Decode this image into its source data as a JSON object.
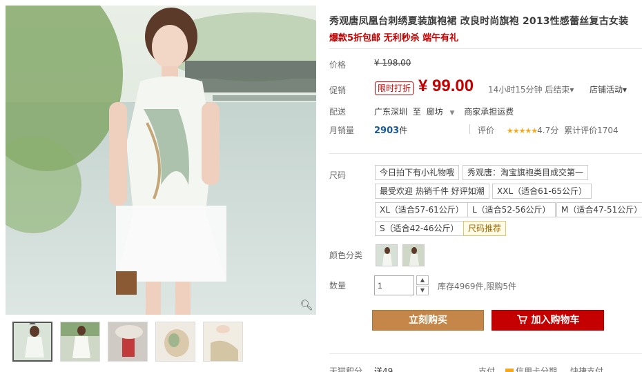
{
  "product": {
    "title": "秀观唐凤凰台刺绣夏装旗袍裙 改良时尚旗袍 2013性感蕾丝复古女装",
    "subtitle": "爆款5折包邮 无利秒杀 端午有礼"
  },
  "price": {
    "label": "价格",
    "original": "¥ 198.00"
  },
  "promo": {
    "label": "促销",
    "tag": "限时打折",
    "price": "¥ 99.00",
    "countdown": "14小时15分钟 后结束▾",
    "shop_activity": "店铺活动▾"
  },
  "shipping": {
    "label": "配送",
    "origin": "广东深圳",
    "to": "至",
    "destination": "廊坊",
    "dest_arrow": "▼",
    "note": "商家承担运费"
  },
  "sales": {
    "label": "月销量",
    "count": "2903",
    "unit": "件",
    "rating_label": "评价",
    "stars": "★★★★★",
    "score": "4.7分",
    "cumulative": "累计评价1704"
  },
  "size": {
    "label": "尺码",
    "options": [
      "今日拍下有小礼物哦",
      "秀观唐：淘宝旗袍类目成交第一",
      "最受欢迎 热销千件 好评如潮",
      "XXL（适合61-65公斤）",
      "XL（适合57-61公斤）",
      "L（适合52-56公斤）",
      "M（适合47-51公斤）",
      "S（适合42-46公斤）",
      "尺码推荐"
    ]
  },
  "color": {
    "label": "颜色分类"
  },
  "quantity": {
    "label": "数量",
    "value": "1",
    "up": "▲",
    "down": "▼",
    "stock": "库存4969件,限购5件"
  },
  "actions": {
    "buy": "立刻购买",
    "cart": "加入购物车"
  },
  "bottom": {
    "points_label": "天猫积分",
    "points_value": "送49",
    "pay_label": "支付",
    "credit": "信用卡分期",
    "quick": "快捷支付"
  },
  "icons": {
    "zoom": "magnifier-icon",
    "cart": "cart-icon"
  },
  "colors": {
    "accent": "#c40000",
    "buy": "#c48749",
    "stars": "#f4a81d"
  }
}
